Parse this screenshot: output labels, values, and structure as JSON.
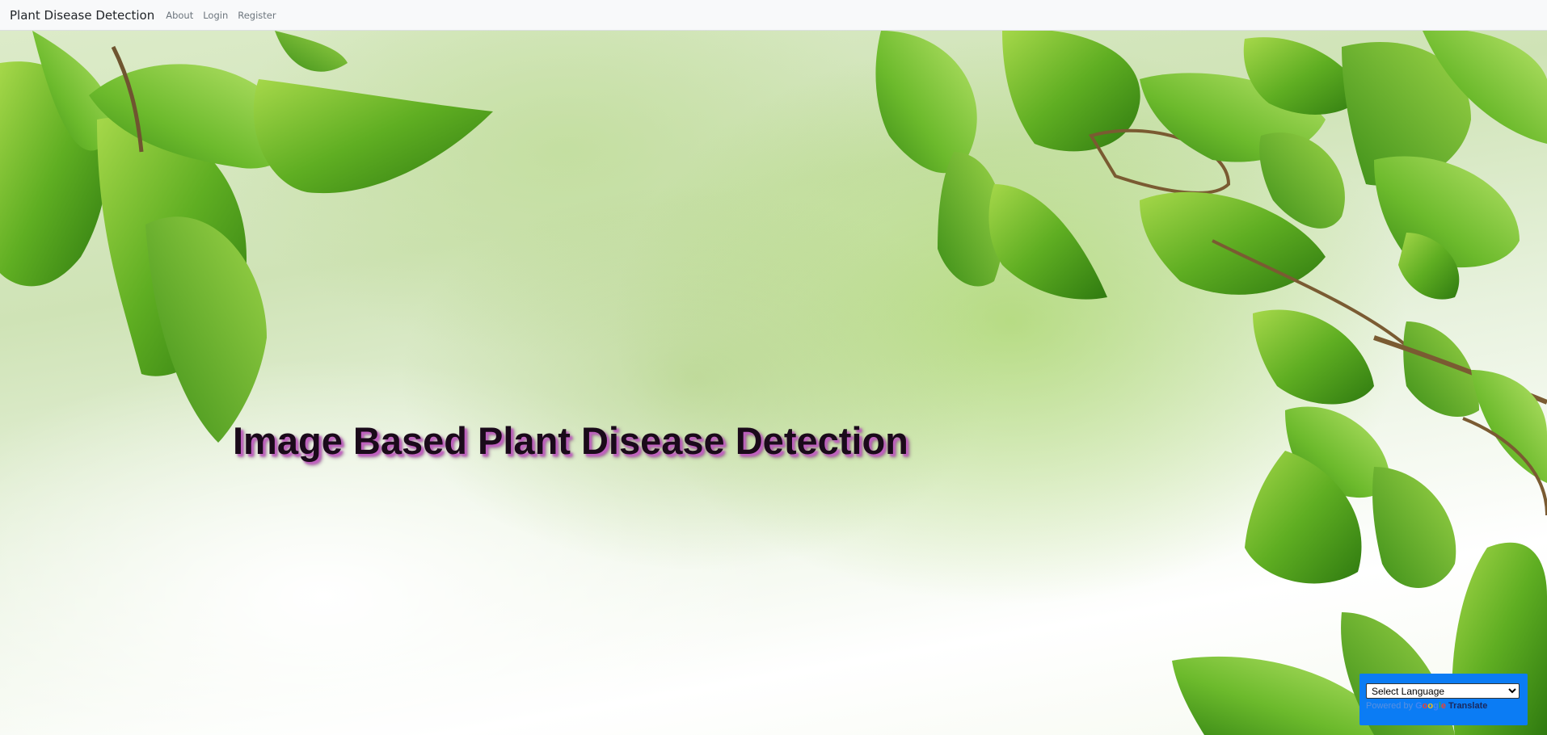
{
  "navbar": {
    "brand": "Plant Disease Detection",
    "links": [
      "About",
      "Login",
      "Register"
    ]
  },
  "hero": {
    "title": "Image Based Plant Disease Detection",
    "background_image": "green-leaves-background"
  },
  "translate_widget": {
    "select_value": "Select Language",
    "powered_by": "Powered by",
    "google": "Google",
    "translate": "Translate"
  },
  "colors": {
    "navbar_bg": "#f8f9fa",
    "widget_bg": "#0b7cf4",
    "title_color": "#1a0a1a",
    "title_shadow": "#c060c0"
  }
}
